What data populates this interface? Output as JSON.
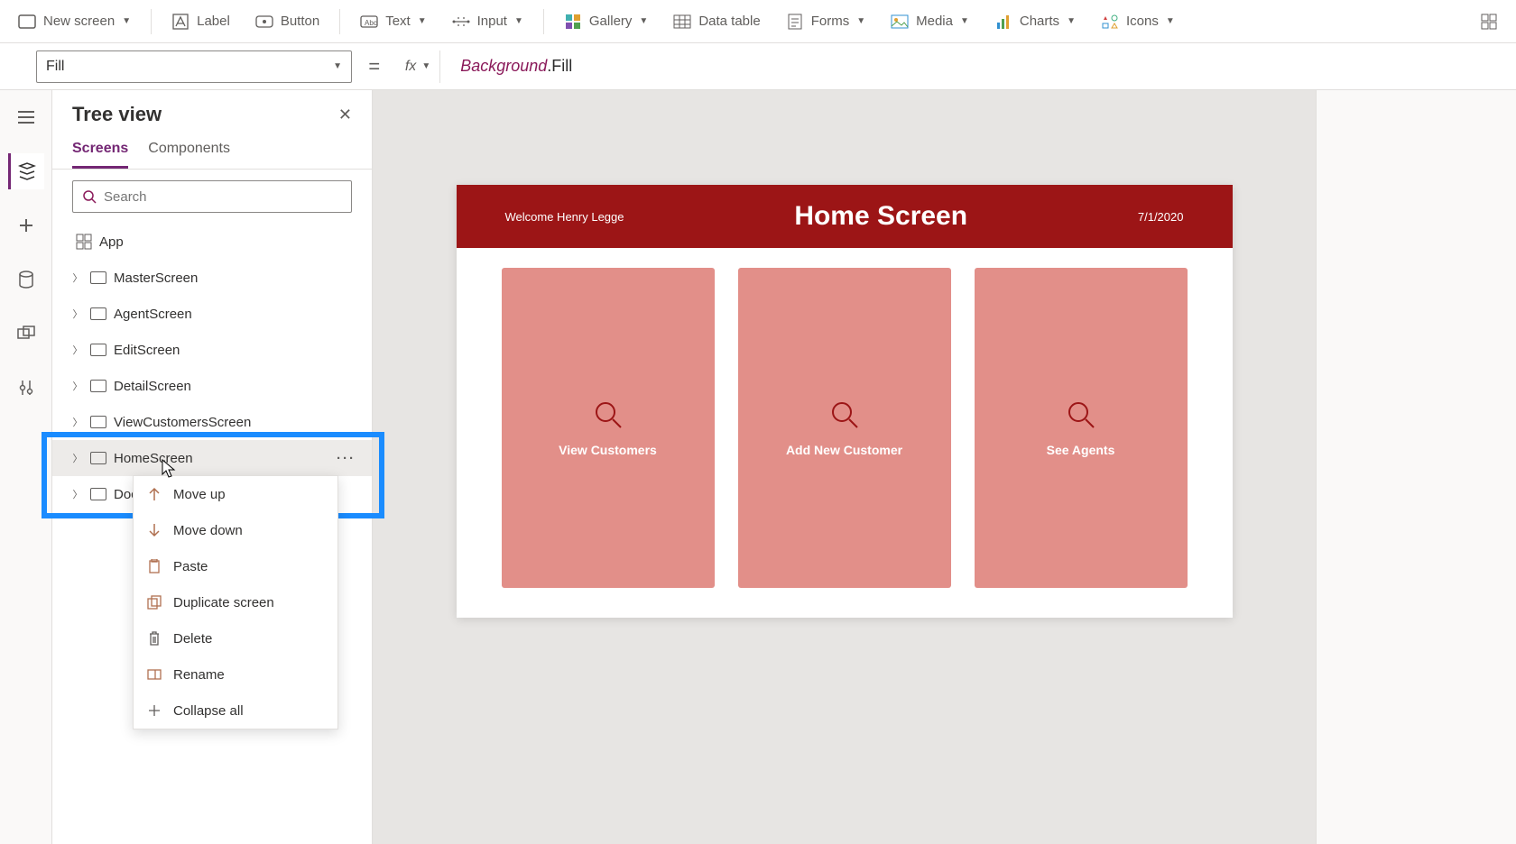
{
  "toolbar": {
    "newScreen": "New screen",
    "label": "Label",
    "button": "Button",
    "text": "Text",
    "input": "Input",
    "gallery": "Gallery",
    "dataTable": "Data table",
    "forms": "Forms",
    "media": "Media",
    "charts": "Charts",
    "icons": "Icons"
  },
  "formulaBar": {
    "property": "Fill",
    "formulaIdent": "Background",
    "formulaProp": ".Fill"
  },
  "treePanel": {
    "title": "Tree view",
    "tabs": {
      "screens": "Screens",
      "components": "Components"
    },
    "searchPlaceholder": "Search",
    "app": "App",
    "items": [
      "MasterScreen",
      "AgentScreen",
      "EditScreen",
      "DetailScreen",
      "ViewCustomersScreen",
      "HomeScreen",
      "Doc"
    ]
  },
  "contextMenu": {
    "moveUp": "Move up",
    "moveDown": "Move down",
    "paste": "Paste",
    "duplicate": "Duplicate screen",
    "delete": "Delete",
    "rename": "Rename",
    "collapseAll": "Collapse all"
  },
  "canvas": {
    "welcome": "Welcome Henry Legge",
    "title": "Home Screen",
    "date": "7/1/2020",
    "cards": [
      "View Customers",
      "Add New Customer",
      "See Agents"
    ]
  }
}
